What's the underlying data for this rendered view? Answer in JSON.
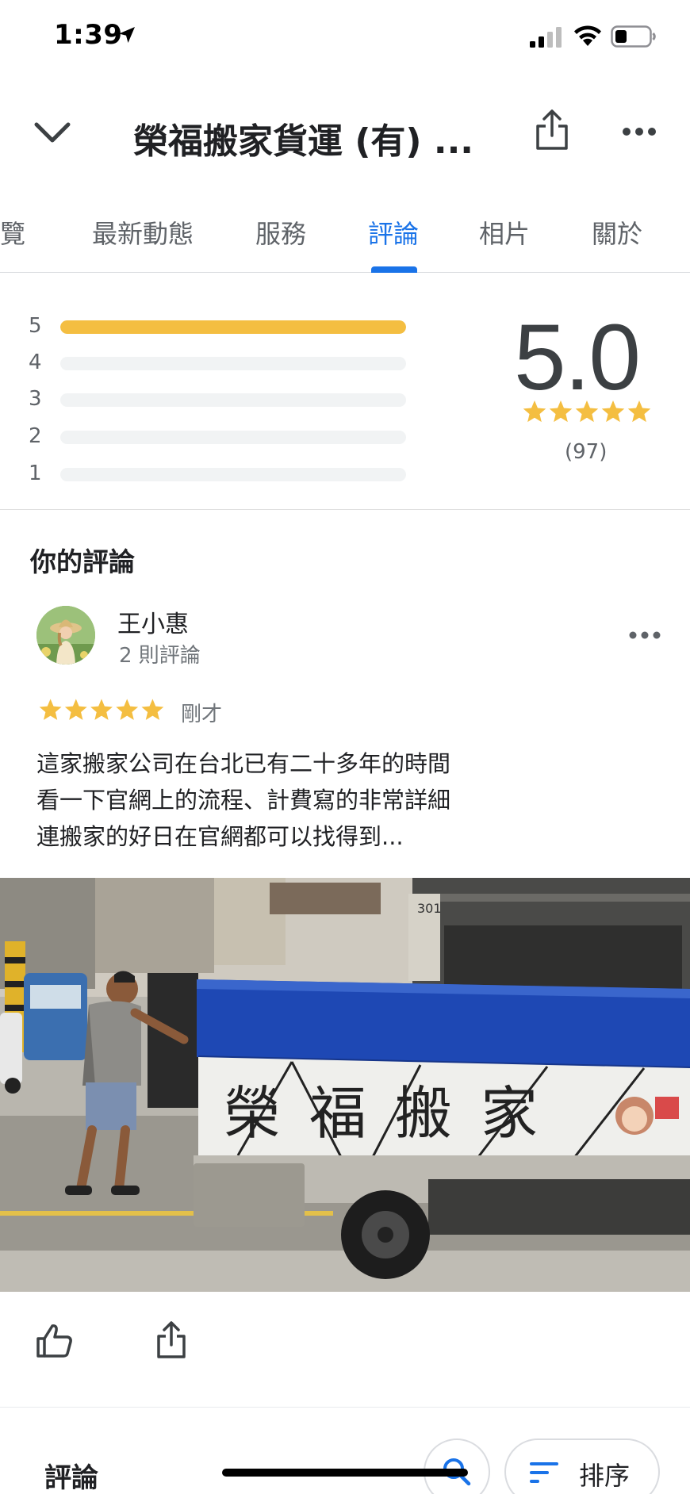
{
  "status_bar": {
    "time": "1:39"
  },
  "header": {
    "title": "榮福搬家貨運 (有) ..."
  },
  "tabs": [
    {
      "label": "總覽",
      "active": false
    },
    {
      "label": "最新動態",
      "active": false
    },
    {
      "label": "服務",
      "active": false
    },
    {
      "label": "評論",
      "active": true
    },
    {
      "label": "相片",
      "active": false
    },
    {
      "label": "關於",
      "active": false
    }
  ],
  "rating_summary": {
    "average": "5.0",
    "count": "(97)",
    "stars": 5,
    "distribution": [
      {
        "label": "5",
        "fraction": 1.0
      },
      {
        "label": "4",
        "fraction": 0
      },
      {
        "label": "3",
        "fraction": 0
      },
      {
        "label": "2",
        "fraction": 0
      },
      {
        "label": "1",
        "fraction": 0
      }
    ]
  },
  "your_review": {
    "section_title": "你的評論",
    "reviewer_name": "王小惠",
    "reviewer_meta": "2 則評論",
    "rating": 5,
    "time": "剛才",
    "text_lines": [
      "這家搬家公司在台北已有二十多年的時間",
      "看一下官網上的流程、計費寫的非常詳細",
      "連搬家的好日在官網都可以找得到..."
    ],
    "photo": {
      "truck_text": "榮福搬家",
      "sign_number": "301"
    }
  },
  "bottom": {
    "title": "評論",
    "sort_label": "排序"
  },
  "colors": {
    "accent": "#1a73e8",
    "star": "#f4be41",
    "bar_empty": "#f1f3f4"
  }
}
